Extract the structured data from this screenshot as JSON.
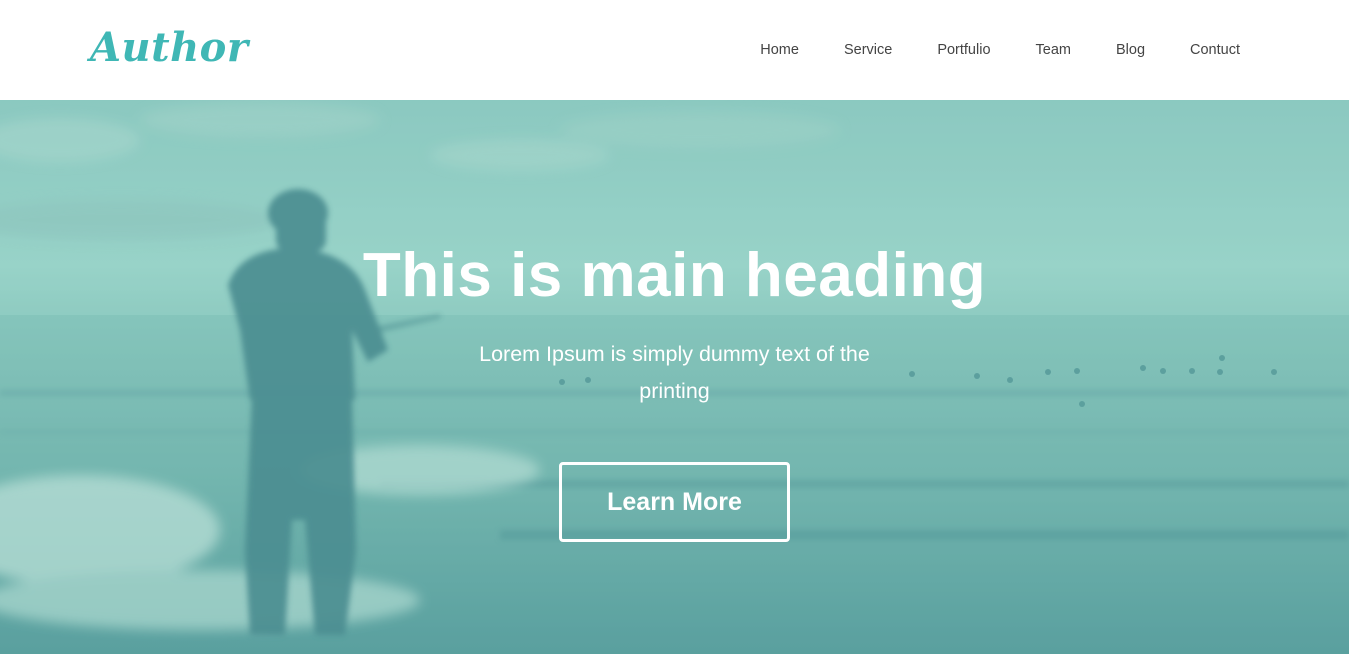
{
  "header": {
    "logo": "Author",
    "nav": [
      "Home",
      "Service",
      "Portfulio",
      "Team",
      "Blog",
      "Contuct"
    ]
  },
  "hero": {
    "heading": "This is main heading",
    "subtext": "Lorem Ipsum is simply dummy text of the printing",
    "button_label": "Learn More",
    "background_image": "man fishing at the seashore with teal overlay"
  },
  "colors": {
    "accent": "#3fb7b5",
    "nav_text": "#444444",
    "overlay": "#7fc8bc",
    "hero_text": "#ffffff"
  }
}
